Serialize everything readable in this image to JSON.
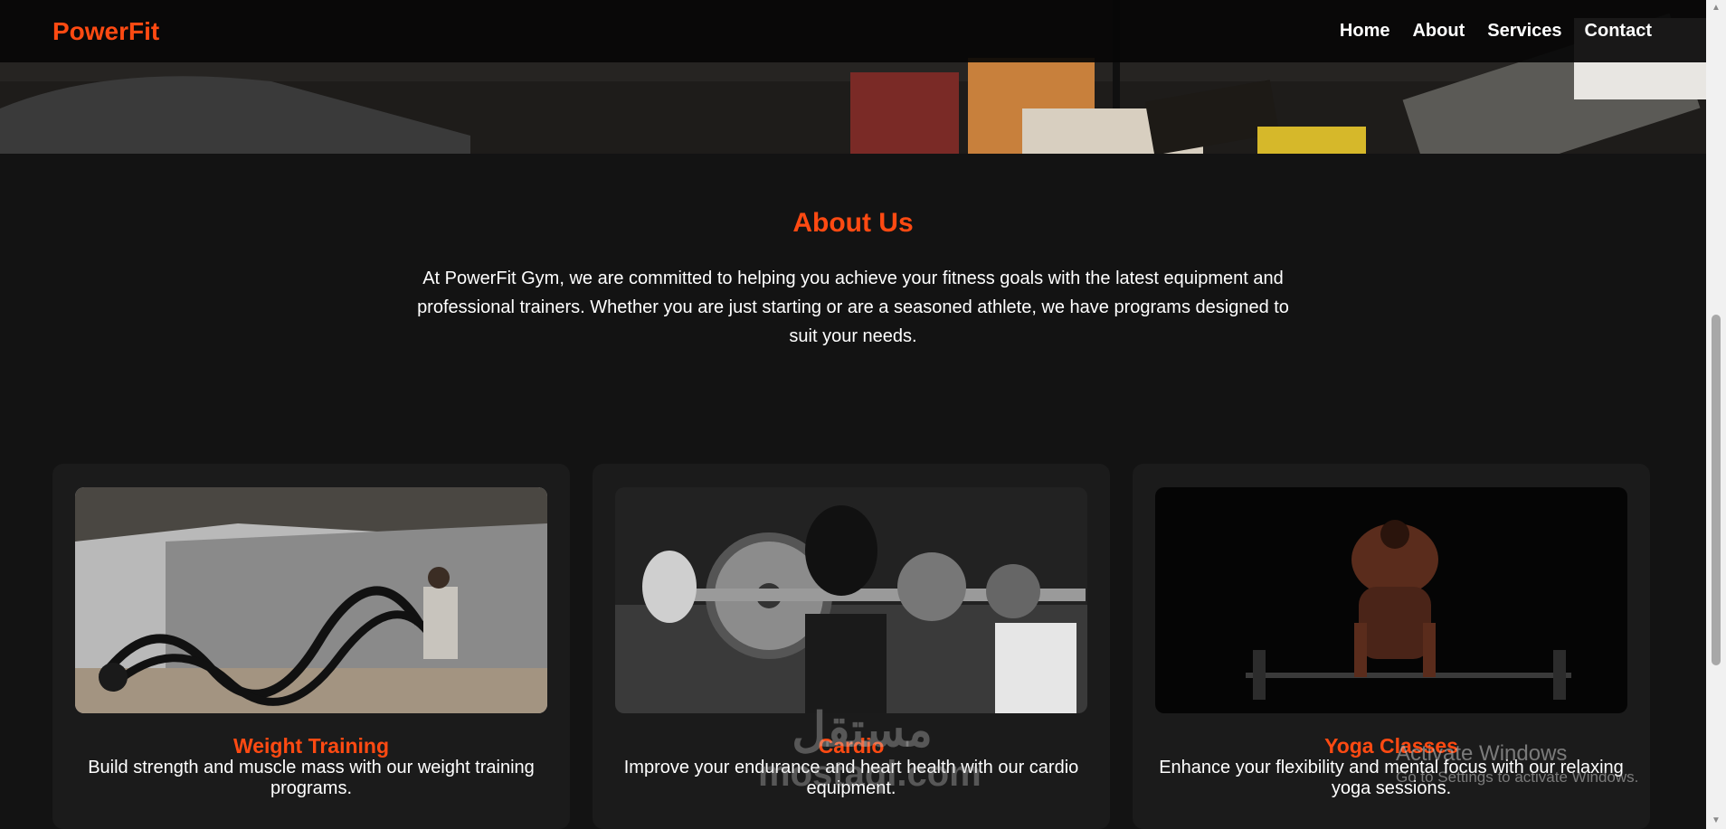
{
  "brand": {
    "name": "PowerFit"
  },
  "nav": {
    "items": [
      {
        "label": "Home"
      },
      {
        "label": "About"
      },
      {
        "label": "Services"
      },
      {
        "label": "Contact"
      }
    ]
  },
  "about": {
    "title": "About Us",
    "text": "At PowerFit Gym, we are committed to helping you achieve your fitness goals with the latest equipment and professional trainers. Whether you are just starting or are a seasoned athlete, we have programs designed to suit your needs."
  },
  "services": [
    {
      "title": "Weight Training",
      "description": "Build strength and muscle mass with our weight training programs."
    },
    {
      "title": "Cardio",
      "description": "Improve your endurance and heart health with our cardio equipment."
    },
    {
      "title": "Yoga Classes",
      "description": "Enhance your flexibility and mental focus with our relaxing yoga sessions."
    }
  ],
  "watermark": {
    "arabic": "مستقل",
    "latin": "mostaql.com"
  },
  "system_overlay": {
    "activate_title": "Activate Windows",
    "activate_subtitle": "Go to Settings to activate Windows."
  },
  "colors": {
    "accent": "#ff4a12",
    "background": "#131313",
    "card": "#1b1b1b",
    "navbar": "#060606"
  }
}
